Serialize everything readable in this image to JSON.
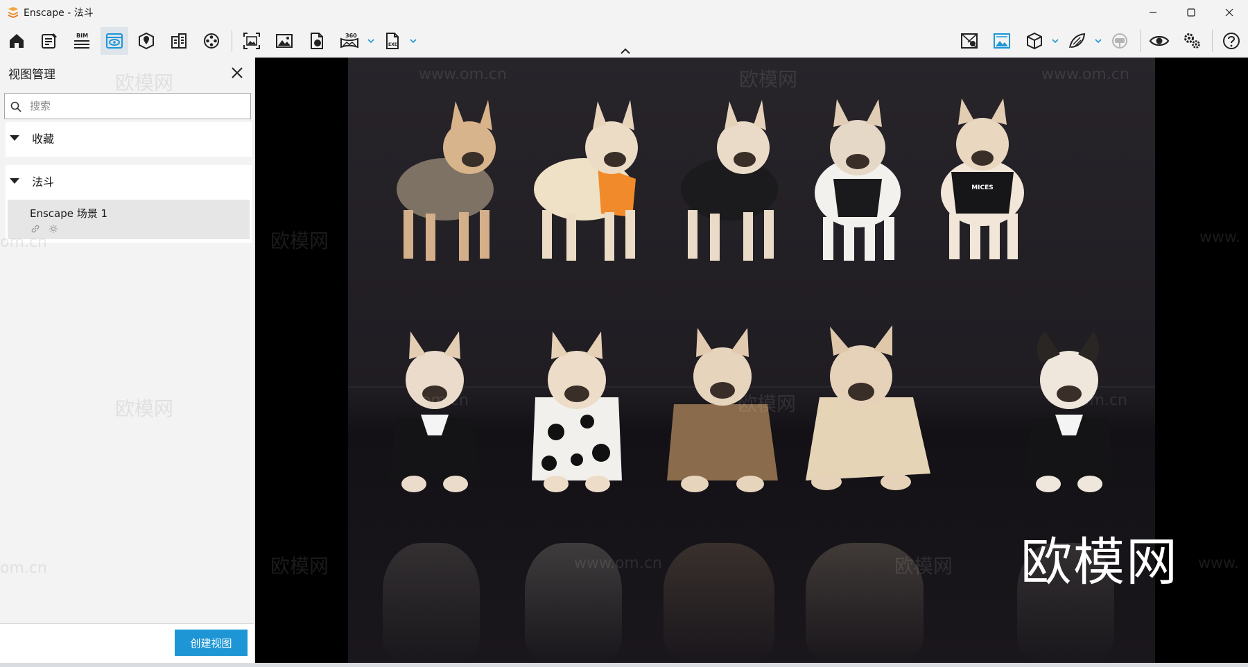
{
  "window": {
    "title": "Enscape - 法斗",
    "controls": [
      "minimize-icon",
      "maximize-icon",
      "close-icon"
    ]
  },
  "toolbar": {
    "left_buttons": [
      {
        "name": "home-icon"
      },
      {
        "name": "notes-icon"
      },
      {
        "name": "bim-icon",
        "label": "BIM"
      },
      {
        "name": "view-management-icon",
        "active": true
      },
      {
        "name": "map-pin-icon"
      },
      {
        "name": "building-icon"
      },
      {
        "name": "video-reel-icon"
      },
      {
        "name": "screenshot-icon"
      },
      {
        "name": "image-icon"
      },
      {
        "name": "web-standalone-icon"
      },
      {
        "name": "panorama-360-icon",
        "label": "360°"
      },
      {
        "name": "exe-export-icon",
        "label": "EXE"
      }
    ],
    "right_buttons": [
      {
        "name": "map-view-icon"
      },
      {
        "name": "visual-settings-icon"
      },
      {
        "name": "asset-cube-icon"
      },
      {
        "name": "material-leaf-icon"
      },
      {
        "name": "vr-headset-icon"
      },
      {
        "name": "eye-icon"
      },
      {
        "name": "settings-icon"
      },
      {
        "name": "help-icon"
      }
    ],
    "accent_color": "#1e96d6"
  },
  "panel": {
    "title": "视图管理",
    "search": {
      "placeholder": "搜索",
      "value": ""
    },
    "groups": [
      {
        "label": "收藏",
        "expanded": true,
        "items": []
      },
      {
        "label": "法斗",
        "expanded": true,
        "items": [
          {
            "label": "Enscape 场景 1",
            "icons": [
              "link-icon",
              "sun-icon"
            ]
          }
        ]
      }
    ],
    "create_button": "创建视图"
  },
  "viewport": {
    "watermark_big": "欧模网",
    "watermark_small_cn": "欧模网",
    "watermark_url": "www.om.cn",
    "watermark_frag": "om.cn",
    "watermark_www": "www.",
    "dog_shirt_text": "MICES"
  }
}
